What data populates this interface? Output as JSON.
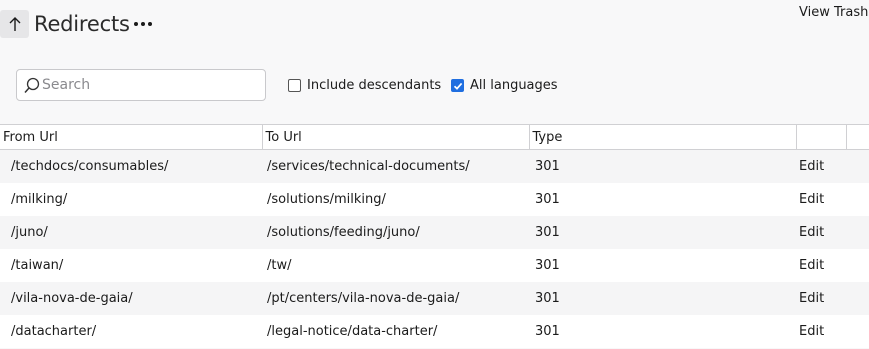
{
  "header": {
    "title": "Redirects",
    "view_trash_label": "View Trash"
  },
  "toolbar": {
    "search_placeholder": "Search",
    "search_value": "",
    "include_descendants": {
      "label": "Include descendants",
      "checked": false
    },
    "all_languages": {
      "label": "All languages",
      "checked": true
    }
  },
  "table": {
    "columns": [
      "From Url",
      "To Url",
      "Type",
      "",
      ""
    ],
    "rows": [
      {
        "from": "/techdocs/consumables/",
        "to": "/services/technical-documents/",
        "type": "301",
        "action": "Edit"
      },
      {
        "from": "/milking/",
        "to": "/solutions/milking/",
        "type": "301",
        "action": "Edit"
      },
      {
        "from": "/juno/",
        "to": "/solutions/feeding/juno/",
        "type": "301",
        "action": "Edit"
      },
      {
        "from": "/taiwan/",
        "to": "/tw/",
        "type": "301",
        "action": "Edit"
      },
      {
        "from": "/vila-nova-de-gaia/",
        "to": "/pt/centers/vila-nova-de-gaia/",
        "type": "301",
        "action": "Edit"
      },
      {
        "from": "/datacharter/",
        "to": "/legal-notice/data-charter/",
        "type": "301",
        "action": "Edit"
      }
    ]
  },
  "icons": {
    "up": "arrow-up-icon",
    "more": "more-horizontal-icon",
    "search": "search-icon",
    "check": "checkmark-icon"
  },
  "colors": {
    "accent": "#1f6ee0",
    "page_background": "#f8f8f9",
    "row_stripe": "#f5f5f6"
  }
}
